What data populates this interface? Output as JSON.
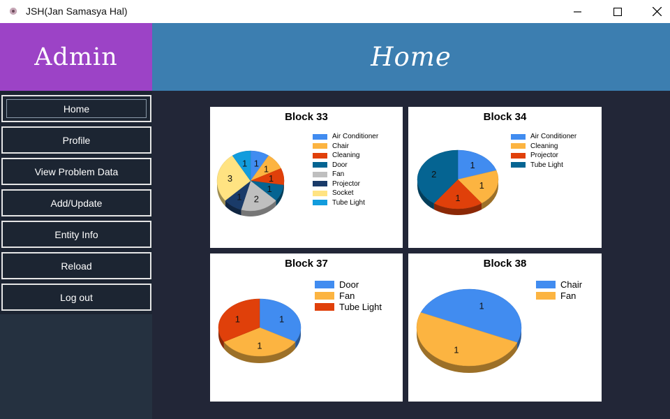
{
  "window": {
    "title": "JSH(Jan Samasya Hal)",
    "controls": [
      "minimize-icon",
      "maximize-icon",
      "close-icon"
    ]
  },
  "sidebar": {
    "brand": "Admin",
    "items": [
      {
        "label": "Home",
        "active": true
      },
      {
        "label": "Profile"
      },
      {
        "label": "View Problem Data"
      },
      {
        "label": "Add/Update"
      },
      {
        "label": "Entity Info"
      },
      {
        "label": "Reload"
      },
      {
        "label": "Log out"
      }
    ]
  },
  "header": {
    "title": "Home"
  },
  "colors": {
    "brand_purple": "#9c43c6",
    "header_blue": "#3c7eb0",
    "sidebar_bg": "#253140",
    "main_bg": "#222637"
  },
  "chart_data": [
    {
      "type": "pie",
      "title": "Block 33",
      "series": [
        {
          "name": "Air Conditioner",
          "value": 1,
          "color": "#418cf0"
        },
        {
          "name": "Chair",
          "value": 1,
          "color": "#fcb441"
        },
        {
          "name": "Cleaning",
          "value": 1,
          "color": "#e0400a"
        },
        {
          "name": "Door",
          "value": 1,
          "color": "#056492"
        },
        {
          "name": "Fan",
          "value": 2,
          "color": "#bfbfbf"
        },
        {
          "name": "Projector",
          "value": 1,
          "color": "#1a3b69"
        },
        {
          "name": "Socket",
          "value": 3,
          "color": "#ffe382"
        },
        {
          "name": "Tube Light",
          "value": 1,
          "color": "#129cdd"
        }
      ]
    },
    {
      "type": "pie",
      "title": "Block 34",
      "series": [
        {
          "name": "Air Conditioner",
          "value": 1,
          "color": "#418cf0"
        },
        {
          "name": "Cleaning",
          "value": 1,
          "color": "#fcb441"
        },
        {
          "name": "Projector",
          "value": 1,
          "color": "#e0400a"
        },
        {
          "name": "Tube Light",
          "value": 2,
          "color": "#056492"
        }
      ]
    },
    {
      "type": "pie",
      "title": "Block 37",
      "series": [
        {
          "name": "Door",
          "value": 1,
          "color": "#418cf0"
        },
        {
          "name": "Fan",
          "value": 1,
          "color": "#fcb441"
        },
        {
          "name": "Tube Light",
          "value": 1,
          "color": "#e0400a"
        }
      ]
    },
    {
      "type": "pie",
      "title": "Block 38",
      "series": [
        {
          "name": "Chair",
          "value": 1,
          "color": "#418cf0"
        },
        {
          "name": "Fan",
          "value": 1,
          "color": "#fcb441"
        }
      ]
    }
  ]
}
